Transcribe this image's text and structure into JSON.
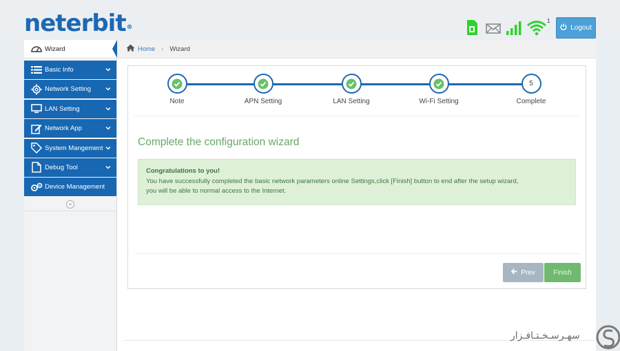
{
  "header": {
    "logo_text": "neterbit",
    "logo_mark": "®",
    "wifi_badge": "1",
    "logout_label": "Logout",
    "colors": {
      "brand": "#1c68b3",
      "signal": "#2fd12f",
      "logout_bg": "#4da0d8"
    }
  },
  "sidebar": {
    "items": [
      {
        "label": "Wizard",
        "icon": "dashboard-icon",
        "active": true
      },
      {
        "label": "Basic Info",
        "icon": "list-icon"
      },
      {
        "label": "Network Setting",
        "icon": "gear-icon"
      },
      {
        "label": "LAN Setting",
        "icon": "monitor-icon"
      },
      {
        "label": "Network App",
        "icon": "edit-icon"
      },
      {
        "label": "System Mangement",
        "icon": "tag-icon"
      },
      {
        "label": "Debug Tool",
        "icon": "file-icon"
      },
      {
        "label": "Device Management",
        "icon": "gears-icon"
      }
    ],
    "collapse_icon": "«"
  },
  "breadcrumb": {
    "home": "Home",
    "current": "Wizard"
  },
  "wizard": {
    "steps": [
      {
        "label": "Note",
        "done": true
      },
      {
        "label": "APN Setting",
        "done": true
      },
      {
        "label": "LAN Setting",
        "done": true
      },
      {
        "label": "Wi-Fi Setting",
        "done": true
      },
      {
        "label": "Complete",
        "done": false,
        "number": "5"
      }
    ],
    "title": "Complete the configuration wizard",
    "alert_heading": "Congratulations to you!",
    "alert_line1": "You have successfully completed the basic network parameters online Settings,click [Finish] button to end after the setup wizard,",
    "alert_line2": "you will be able to normal access to the Internet.",
    "prev_label": "Prev",
    "finish_label": "Finish"
  },
  "watermark": {
    "text": "سهـرسـخـتـافـزار"
  }
}
